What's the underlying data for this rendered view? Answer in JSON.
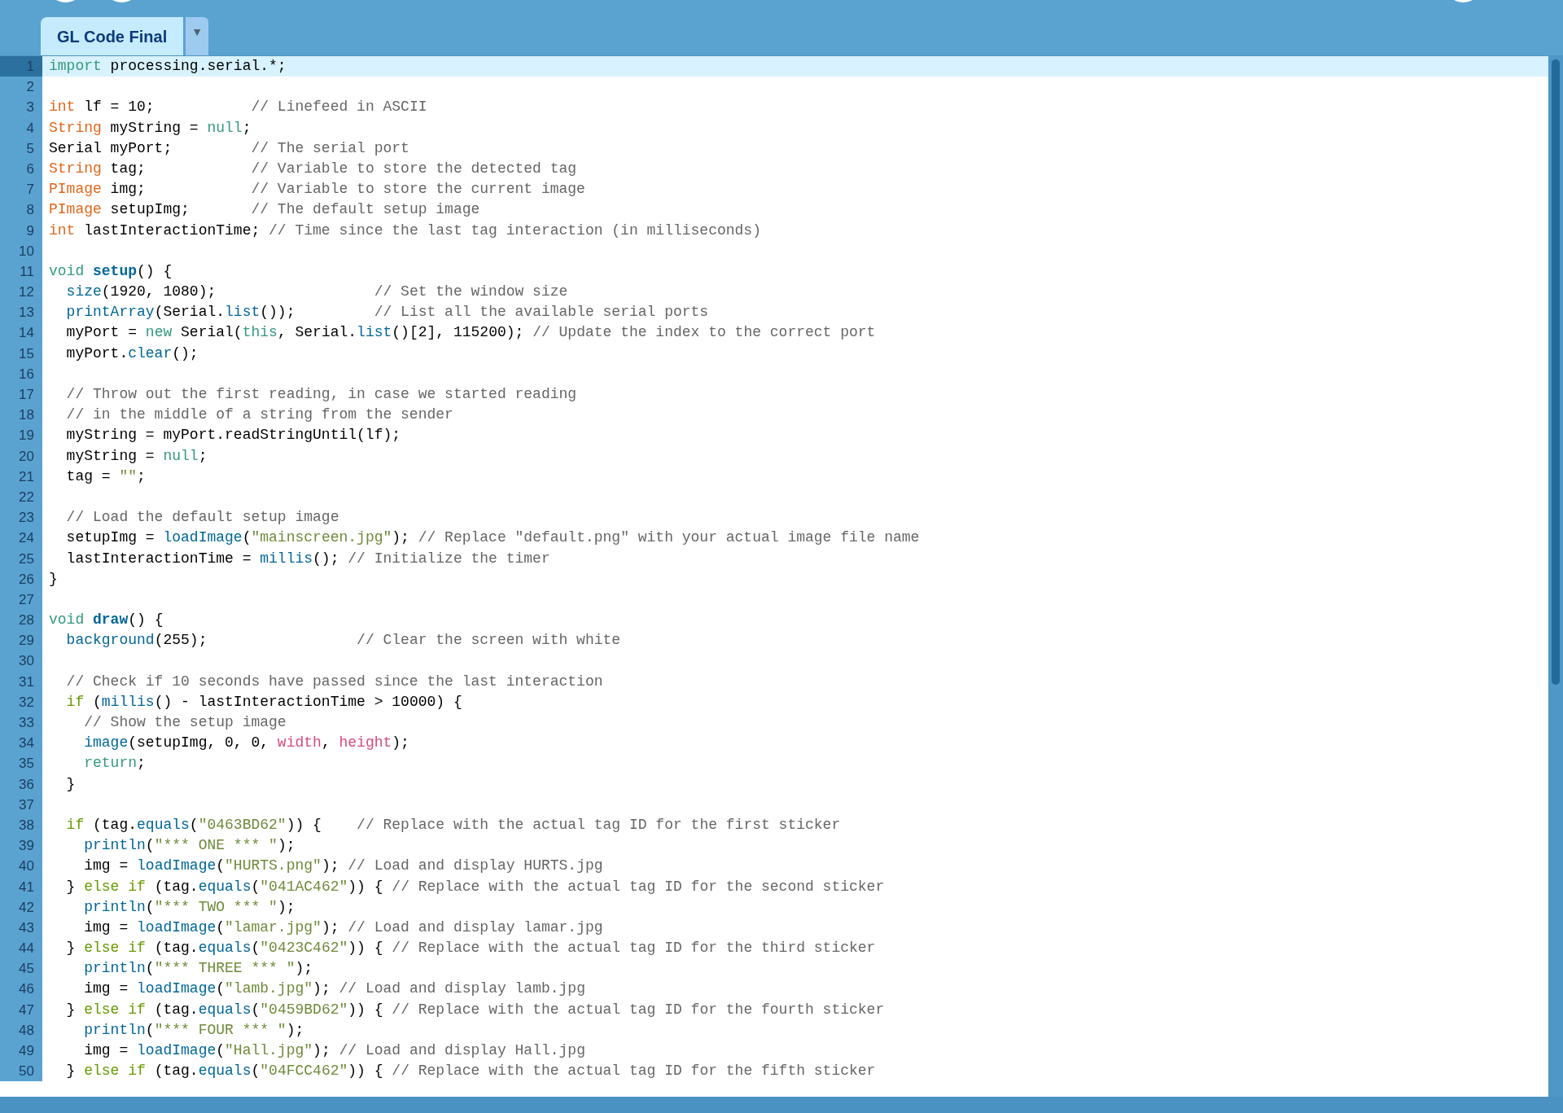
{
  "toolbar": {
    "buttons": [
      {
        "kind": "round"
      },
      {
        "kind": "round"
      },
      {
        "kind": "round"
      }
    ]
  },
  "tabs": [
    {
      "label": "GL Code Final",
      "selected": true
    }
  ],
  "tab_menu": {
    "label": "▼"
  },
  "editor": {
    "lines": [
      {
        "number": "1",
        "selected": true,
        "tokens": [
          {
            "kind": "keyword",
            "text": "import"
          },
          {
            "kind": "plain",
            "text": " processing.serial.*;"
          }
        ]
      },
      {
        "number": "2",
        "selected": false
      },
      {
        "number": "3",
        "selected": false,
        "tokens": [
          {
            "kind": "type",
            "text": "int"
          },
          {
            "kind": "plain",
            "text": " lf = 10;           "
          },
          {
            "kind": "comment",
            "text": "// Linefeed in ASCII"
          }
        ]
      },
      {
        "number": "4",
        "selected": false,
        "tokens": [
          {
            "kind": "type",
            "text": "String"
          },
          {
            "kind": "plain",
            "text": " myString = "
          },
          {
            "kind": "keyword",
            "text": "null"
          },
          {
            "kind": "plain",
            "text": ";"
          }
        ]
      },
      {
        "number": "5",
        "selected": false,
        "tokens": [
          {
            "kind": "plain",
            "text": "Serial myPort;         "
          },
          {
            "kind": "comment",
            "text": "// The serial port"
          }
        ]
      },
      {
        "number": "6",
        "selected": false,
        "tokens": [
          {
            "kind": "type",
            "text": "String"
          },
          {
            "kind": "plain",
            "text": " tag;            "
          },
          {
            "kind": "comment",
            "text": "// Variable to store the detected tag"
          }
        ]
      },
      {
        "number": "7",
        "selected": false,
        "tokens": [
          {
            "kind": "type",
            "text": "PImage"
          },
          {
            "kind": "plain",
            "text": " img;            "
          },
          {
            "kind": "comment",
            "text": "// Variable to store the current image"
          }
        ]
      },
      {
        "number": "8",
        "selected": false,
        "tokens": [
          {
            "kind": "type",
            "text": "PImage"
          },
          {
            "kind": "plain",
            "text": " setupImg;       "
          },
          {
            "kind": "comment",
            "text": "// The default setup image"
          }
        ]
      },
      {
        "number": "9",
        "selected": false,
        "tokens": [
          {
            "kind": "type",
            "text": "int"
          },
          {
            "kind": "plain",
            "text": " lastInteractionTime; "
          },
          {
            "kind": "comment",
            "text": "// Time since the last tag interaction (in milliseconds)"
          }
        ]
      },
      {
        "number": "10",
        "selected": false
      },
      {
        "number": "11",
        "selected": false,
        "tokens": [
          {
            "kind": "keyword",
            "text": "void"
          },
          {
            "kind": "function_def",
            "text": " setup"
          },
          {
            "kind": "plain",
            "text": "() {"
          }
        ]
      },
      {
        "number": "12",
        "selected": false,
        "tokens": [
          {
            "kind": "function",
            "text": "  size"
          },
          {
            "kind": "plain",
            "text": "(1920, 1080);                  "
          },
          {
            "kind": "comment",
            "text": "// Set the window size"
          }
        ]
      },
      {
        "number": "13",
        "selected": false,
        "tokens": [
          {
            "kind": "function",
            "text": "  printArray"
          },
          {
            "kind": "plain",
            "text": "(Serial."
          },
          {
            "kind": "function",
            "text": "list"
          },
          {
            "kind": "plain",
            "text": "());         "
          },
          {
            "kind": "comment",
            "text": "// List all the available serial ports"
          }
        ]
      },
      {
        "number": "14",
        "selected": false,
        "tokens": [
          {
            "kind": "plain",
            "text": "  myPort = "
          },
          {
            "kind": "keyword",
            "text": "new"
          },
          {
            "kind": "plain",
            "text": " Serial("
          },
          {
            "kind": "keyword",
            "text": "this"
          },
          {
            "kind": "plain",
            "text": ", Serial."
          },
          {
            "kind": "function",
            "text": "list"
          },
          {
            "kind": "plain",
            "text": "()[2], 115200); "
          },
          {
            "kind": "comment",
            "text": "// Update the index to the correct port"
          }
        ]
      },
      {
        "number": "15",
        "selected": false,
        "tokens": [
          {
            "kind": "plain",
            "text": "  myPort."
          },
          {
            "kind": "function",
            "text": "clear"
          },
          {
            "kind": "plain",
            "text": "();"
          }
        ]
      },
      {
        "number": "16",
        "selected": false
      },
      {
        "number": "17",
        "selected": false,
        "tokens": [
          {
            "kind": "comment",
            "text": "  // Throw out the first reading, in case we started reading"
          }
        ]
      },
      {
        "number": "18",
        "selected": false,
        "tokens": [
          {
            "kind": "comment",
            "text": "  // in the middle of a string from the sender"
          }
        ]
      },
      {
        "number": "19",
        "selected": false,
        "tokens": [
          {
            "kind": "plain",
            "text": "  myString = myPort.readStringUntil(lf);"
          }
        ]
      },
      {
        "number": "20",
        "selected": false,
        "tokens": [
          {
            "kind": "plain",
            "text": "  myString = "
          },
          {
            "kind": "keyword",
            "text": "null"
          },
          {
            "kind": "plain",
            "text": ";"
          }
        ]
      },
      {
        "number": "21",
        "selected": false,
        "tokens": [
          {
            "kind": "plain",
            "text": "  tag = "
          },
          {
            "kind": "string",
            "text": "\"\""
          },
          {
            "kind": "plain",
            "text": ";"
          }
        ]
      },
      {
        "number": "22",
        "selected": false
      },
      {
        "number": "23",
        "selected": false,
        "tokens": [
          {
            "kind": "comment",
            "text": "  // Load the default setup image"
          }
        ]
      },
      {
        "number": "24",
        "selected": false,
        "tokens": [
          {
            "kind": "plain",
            "text": "  setupImg = "
          },
          {
            "kind": "function",
            "text": "loadImage"
          },
          {
            "kind": "plain",
            "text": "("
          },
          {
            "kind": "string",
            "text": "\"mainscreen.jpg\""
          },
          {
            "kind": "plain",
            "text": "); "
          },
          {
            "kind": "comment",
            "text": "// Replace \"default.png\" with your actual image file name"
          }
        ]
      },
      {
        "number": "25",
        "selected": false,
        "tokens": [
          {
            "kind": "plain",
            "text": "  lastInteractionTime = "
          },
          {
            "kind": "function",
            "text": "millis"
          },
          {
            "kind": "plain",
            "text": "(); "
          },
          {
            "kind": "comment",
            "text": "// Initialize the timer"
          }
        ]
      },
      {
        "number": "26",
        "selected": false,
        "tokens": [
          {
            "kind": "plain",
            "text": "}"
          }
        ]
      },
      {
        "number": "27",
        "selected": false
      },
      {
        "number": "28",
        "selected": false,
        "tokens": [
          {
            "kind": "keyword",
            "text": "void"
          },
          {
            "kind": "function_def",
            "text": " draw"
          },
          {
            "kind": "plain",
            "text": "() {"
          }
        ]
      },
      {
        "number": "29",
        "selected": false,
        "tokens": [
          {
            "kind": "function",
            "text": "  background"
          },
          {
            "kind": "plain",
            "text": "(255);                 "
          },
          {
            "kind": "comment",
            "text": "// Clear the screen with white"
          }
        ]
      },
      {
        "number": "30",
        "selected": false
      },
      {
        "number": "31",
        "selected": false,
        "tokens": [
          {
            "kind": "comment",
            "text": "  // Check if 10 seconds have passed since the last interaction"
          }
        ]
      },
      {
        "number": "32",
        "selected": false,
        "tokens": [
          {
            "kind": "control",
            "text": "  if"
          },
          {
            "kind": "plain",
            "text": " ("
          },
          {
            "kind": "function",
            "text": "millis"
          },
          {
            "kind": "plain",
            "text": "() - lastInteractionTime > 10000) {"
          }
        ]
      },
      {
        "number": "33",
        "selected": false,
        "tokens": [
          {
            "kind": "comment",
            "text": "    // Show the setup image"
          }
        ]
      },
      {
        "number": "34",
        "selected": false,
        "tokens": [
          {
            "kind": "function",
            "text": "    image"
          },
          {
            "kind": "plain",
            "text": "(setupImg, 0, 0, "
          },
          {
            "kind": "constant",
            "text": "width"
          },
          {
            "kind": "plain",
            "text": ", "
          },
          {
            "kind": "constant",
            "text": "height"
          },
          {
            "kind": "plain",
            "text": ");"
          }
        ]
      },
      {
        "number": "35",
        "selected": false,
        "tokens": [
          {
            "kind": "keyword",
            "text": "    return"
          },
          {
            "kind": "plain",
            "text": ";"
          }
        ]
      },
      {
        "number": "36",
        "selected": false,
        "tokens": [
          {
            "kind": "plain",
            "text": "  }"
          }
        ]
      },
      {
        "number": "37",
        "selected": false
      },
      {
        "number": "38",
        "selected": false,
        "tokens": [
          {
            "kind": "control",
            "text": "  if"
          },
          {
            "kind": "plain",
            "text": " (tag."
          },
          {
            "kind": "function",
            "text": "equals"
          },
          {
            "kind": "plain",
            "text": "("
          },
          {
            "kind": "string",
            "text": "\"0463BD62\""
          },
          {
            "kind": "plain",
            "text": ")) {    "
          },
          {
            "kind": "comment",
            "text": "// Replace with the actual tag ID for the first sticker"
          }
        ]
      },
      {
        "number": "39",
        "selected": false,
        "tokens": [
          {
            "kind": "function",
            "text": "    println"
          },
          {
            "kind": "plain",
            "text": "("
          },
          {
            "kind": "string",
            "text": "\"*** ONE *** \""
          },
          {
            "kind": "plain",
            "text": ");"
          }
        ]
      },
      {
        "number": "40",
        "selected": false,
        "tokens": [
          {
            "kind": "plain",
            "text": "    img = "
          },
          {
            "kind": "function",
            "text": "loadImage"
          },
          {
            "kind": "plain",
            "text": "("
          },
          {
            "kind": "string",
            "text": "\"HURTS.png\""
          },
          {
            "kind": "plain",
            "text": "); "
          },
          {
            "kind": "comment",
            "text": "// Load and display HURTS.jpg"
          }
        ]
      },
      {
        "number": "41",
        "selected": false,
        "tokens": [
          {
            "kind": "plain",
            "text": "  } "
          },
          {
            "kind": "control",
            "text": "else if"
          },
          {
            "kind": "plain",
            "text": " (tag."
          },
          {
            "kind": "function",
            "text": "equals"
          },
          {
            "kind": "plain",
            "text": "("
          },
          {
            "kind": "string",
            "text": "\"041AC462\""
          },
          {
            "kind": "plain",
            "text": ")) { "
          },
          {
            "kind": "comment",
            "text": "// Replace with the actual tag ID for the second sticker"
          }
        ]
      },
      {
        "number": "42",
        "selected": false,
        "tokens": [
          {
            "kind": "function",
            "text": "    println"
          },
          {
            "kind": "plain",
            "text": "("
          },
          {
            "kind": "string",
            "text": "\"*** TWO *** \""
          },
          {
            "kind": "plain",
            "text": ");"
          }
        ]
      },
      {
        "number": "43",
        "selected": false,
        "tokens": [
          {
            "kind": "plain",
            "text": "    img = "
          },
          {
            "kind": "function",
            "text": "loadImage"
          },
          {
            "kind": "plain",
            "text": "("
          },
          {
            "kind": "string",
            "text": "\"lamar.jpg\""
          },
          {
            "kind": "plain",
            "text": "); "
          },
          {
            "kind": "comment",
            "text": "// Load and display lamar.jpg"
          }
        ]
      },
      {
        "number": "44",
        "selected": false,
        "tokens": [
          {
            "kind": "plain",
            "text": "  } "
          },
          {
            "kind": "control",
            "text": "else if"
          },
          {
            "kind": "plain",
            "text": " (tag."
          },
          {
            "kind": "function",
            "text": "equals"
          },
          {
            "kind": "plain",
            "text": "("
          },
          {
            "kind": "string",
            "text": "\"0423C462\""
          },
          {
            "kind": "plain",
            "text": ")) { "
          },
          {
            "kind": "comment",
            "text": "// Replace with the actual tag ID for the third sticker"
          }
        ]
      },
      {
        "number": "45",
        "selected": false,
        "tokens": [
          {
            "kind": "function",
            "text": "    println"
          },
          {
            "kind": "plain",
            "text": "("
          },
          {
            "kind": "string",
            "text": "\"*** THREE *** \""
          },
          {
            "kind": "plain",
            "text": ");"
          }
        ]
      },
      {
        "number": "46",
        "selected": false,
        "tokens": [
          {
            "kind": "plain",
            "text": "    img = "
          },
          {
            "kind": "function",
            "text": "loadImage"
          },
          {
            "kind": "plain",
            "text": "("
          },
          {
            "kind": "string",
            "text": "\"lamb.jpg\""
          },
          {
            "kind": "plain",
            "text": "); "
          },
          {
            "kind": "comment",
            "text": "// Load and display lamb.jpg"
          }
        ]
      },
      {
        "number": "47",
        "selected": false,
        "tokens": [
          {
            "kind": "plain",
            "text": "  } "
          },
          {
            "kind": "control",
            "text": "else if"
          },
          {
            "kind": "plain",
            "text": " (tag."
          },
          {
            "kind": "function",
            "text": "equals"
          },
          {
            "kind": "plain",
            "text": "("
          },
          {
            "kind": "string",
            "text": "\"0459BD62\""
          },
          {
            "kind": "plain",
            "text": ")) { "
          },
          {
            "kind": "comment",
            "text": "// Replace with the actual tag ID for the fourth sticker"
          }
        ]
      },
      {
        "number": "48",
        "selected": false,
        "tokens": [
          {
            "kind": "function",
            "text": "    println"
          },
          {
            "kind": "plain",
            "text": "("
          },
          {
            "kind": "string",
            "text": "\"*** FOUR *** \""
          },
          {
            "kind": "plain",
            "text": ");"
          }
        ]
      },
      {
        "number": "49",
        "selected": false,
        "tokens": [
          {
            "kind": "plain",
            "text": "    img = "
          },
          {
            "kind": "function",
            "text": "loadImage"
          },
          {
            "kind": "plain",
            "text": "("
          },
          {
            "kind": "string",
            "text": "\"Hall.jpg\""
          },
          {
            "kind": "plain",
            "text": "); "
          },
          {
            "kind": "comment",
            "text": "// Load and display Hall.jpg"
          }
        ]
      },
      {
        "number": "50",
        "selected": false,
        "tokens": [
          {
            "kind": "plain",
            "text": "  } "
          },
          {
            "kind": "control",
            "text": "else if"
          },
          {
            "kind": "plain",
            "text": " (tag."
          },
          {
            "kind": "function",
            "text": "equals"
          },
          {
            "kind": "plain",
            "text": "("
          },
          {
            "kind": "string",
            "text": "\"04FCC462\""
          },
          {
            "kind": "plain",
            "text": ")) { "
          },
          {
            "kind": "comment",
            "text": "// Replace with the actual tag ID for the fifth sticker"
          }
        ]
      }
    ]
  }
}
